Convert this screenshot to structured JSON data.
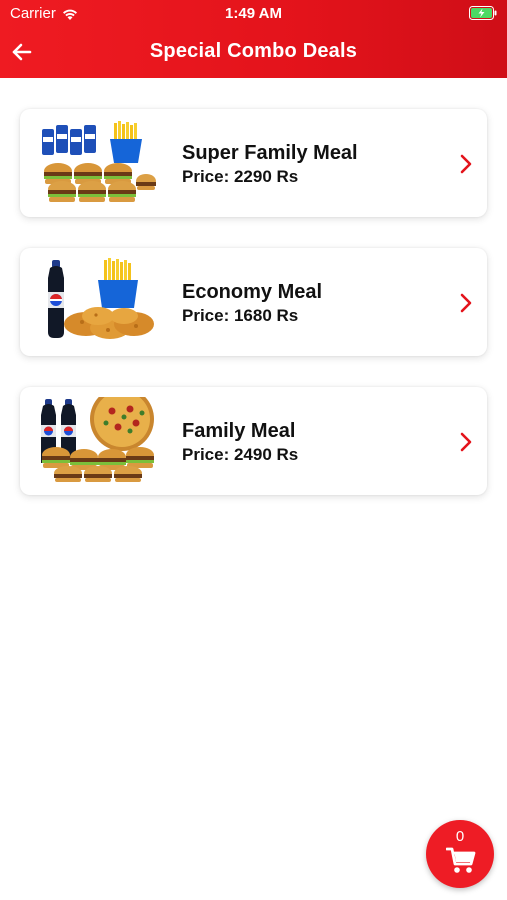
{
  "status_bar": {
    "carrier": "Carrier",
    "time": "1:49 AM"
  },
  "header": {
    "title": "Special Combo Deals",
    "back_icon": "arrow-left-icon"
  },
  "deals": [
    {
      "name": "Super Family Meal",
      "price": "Price: 2290 Rs",
      "image": "burgers-drinks-fries-combo"
    },
    {
      "name": "Economy Meal",
      "price": "Price: 1680 Rs",
      "image": "chicken-fries-pepsi-combo"
    },
    {
      "name": "Family Meal",
      "price": "Price: 2490 Rs",
      "image": "pizza-burgers-pepsi-combo"
    }
  ],
  "cart": {
    "count": "0",
    "icon": "shopping-cart-icon"
  },
  "colors": {
    "brand_red": "#e3131b",
    "text": "#111111"
  }
}
